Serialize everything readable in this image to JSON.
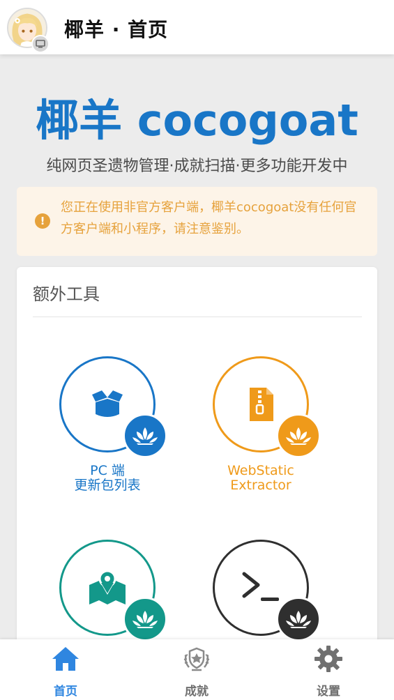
{
  "header": {
    "title": "椰羊 · 首页"
  },
  "hero": {
    "title": "椰羊 cocogoat",
    "subtitle": "纯网页圣遗物管理·成就扫描·更多功能开发中"
  },
  "notice": {
    "icon": "exclamation-icon",
    "text": "您正在使用非官方客户端，椰羊cocogoat没有任何官方客户端和小程序，请注意鉴别。",
    "color": "#e6a23c"
  },
  "tools_card": {
    "title": "额外工具",
    "items": [
      {
        "label": "PC 端\n更新包列表",
        "icon": "box-icon",
        "color": "#1976c7"
      },
      {
        "label": "WebStatic\nExtractor",
        "icon": "zip-file-icon",
        "color": "#ef9a1a"
      },
      {
        "label": "",
        "icon": "map-pin-icon",
        "color": "#13988a"
      },
      {
        "label": "",
        "icon": "terminal-icon",
        "color": "#2f2f2f"
      }
    ]
  },
  "tabbar": {
    "items": [
      {
        "label": "首页",
        "icon": "home-icon",
        "active": true,
        "color": "#2f86e0"
      },
      {
        "label": "成就",
        "icon": "achievement-emblem-icon",
        "active": false,
        "color": "#707070"
      },
      {
        "label": "设置",
        "icon": "gear-icon",
        "active": false,
        "color": "#707070"
      }
    ]
  }
}
